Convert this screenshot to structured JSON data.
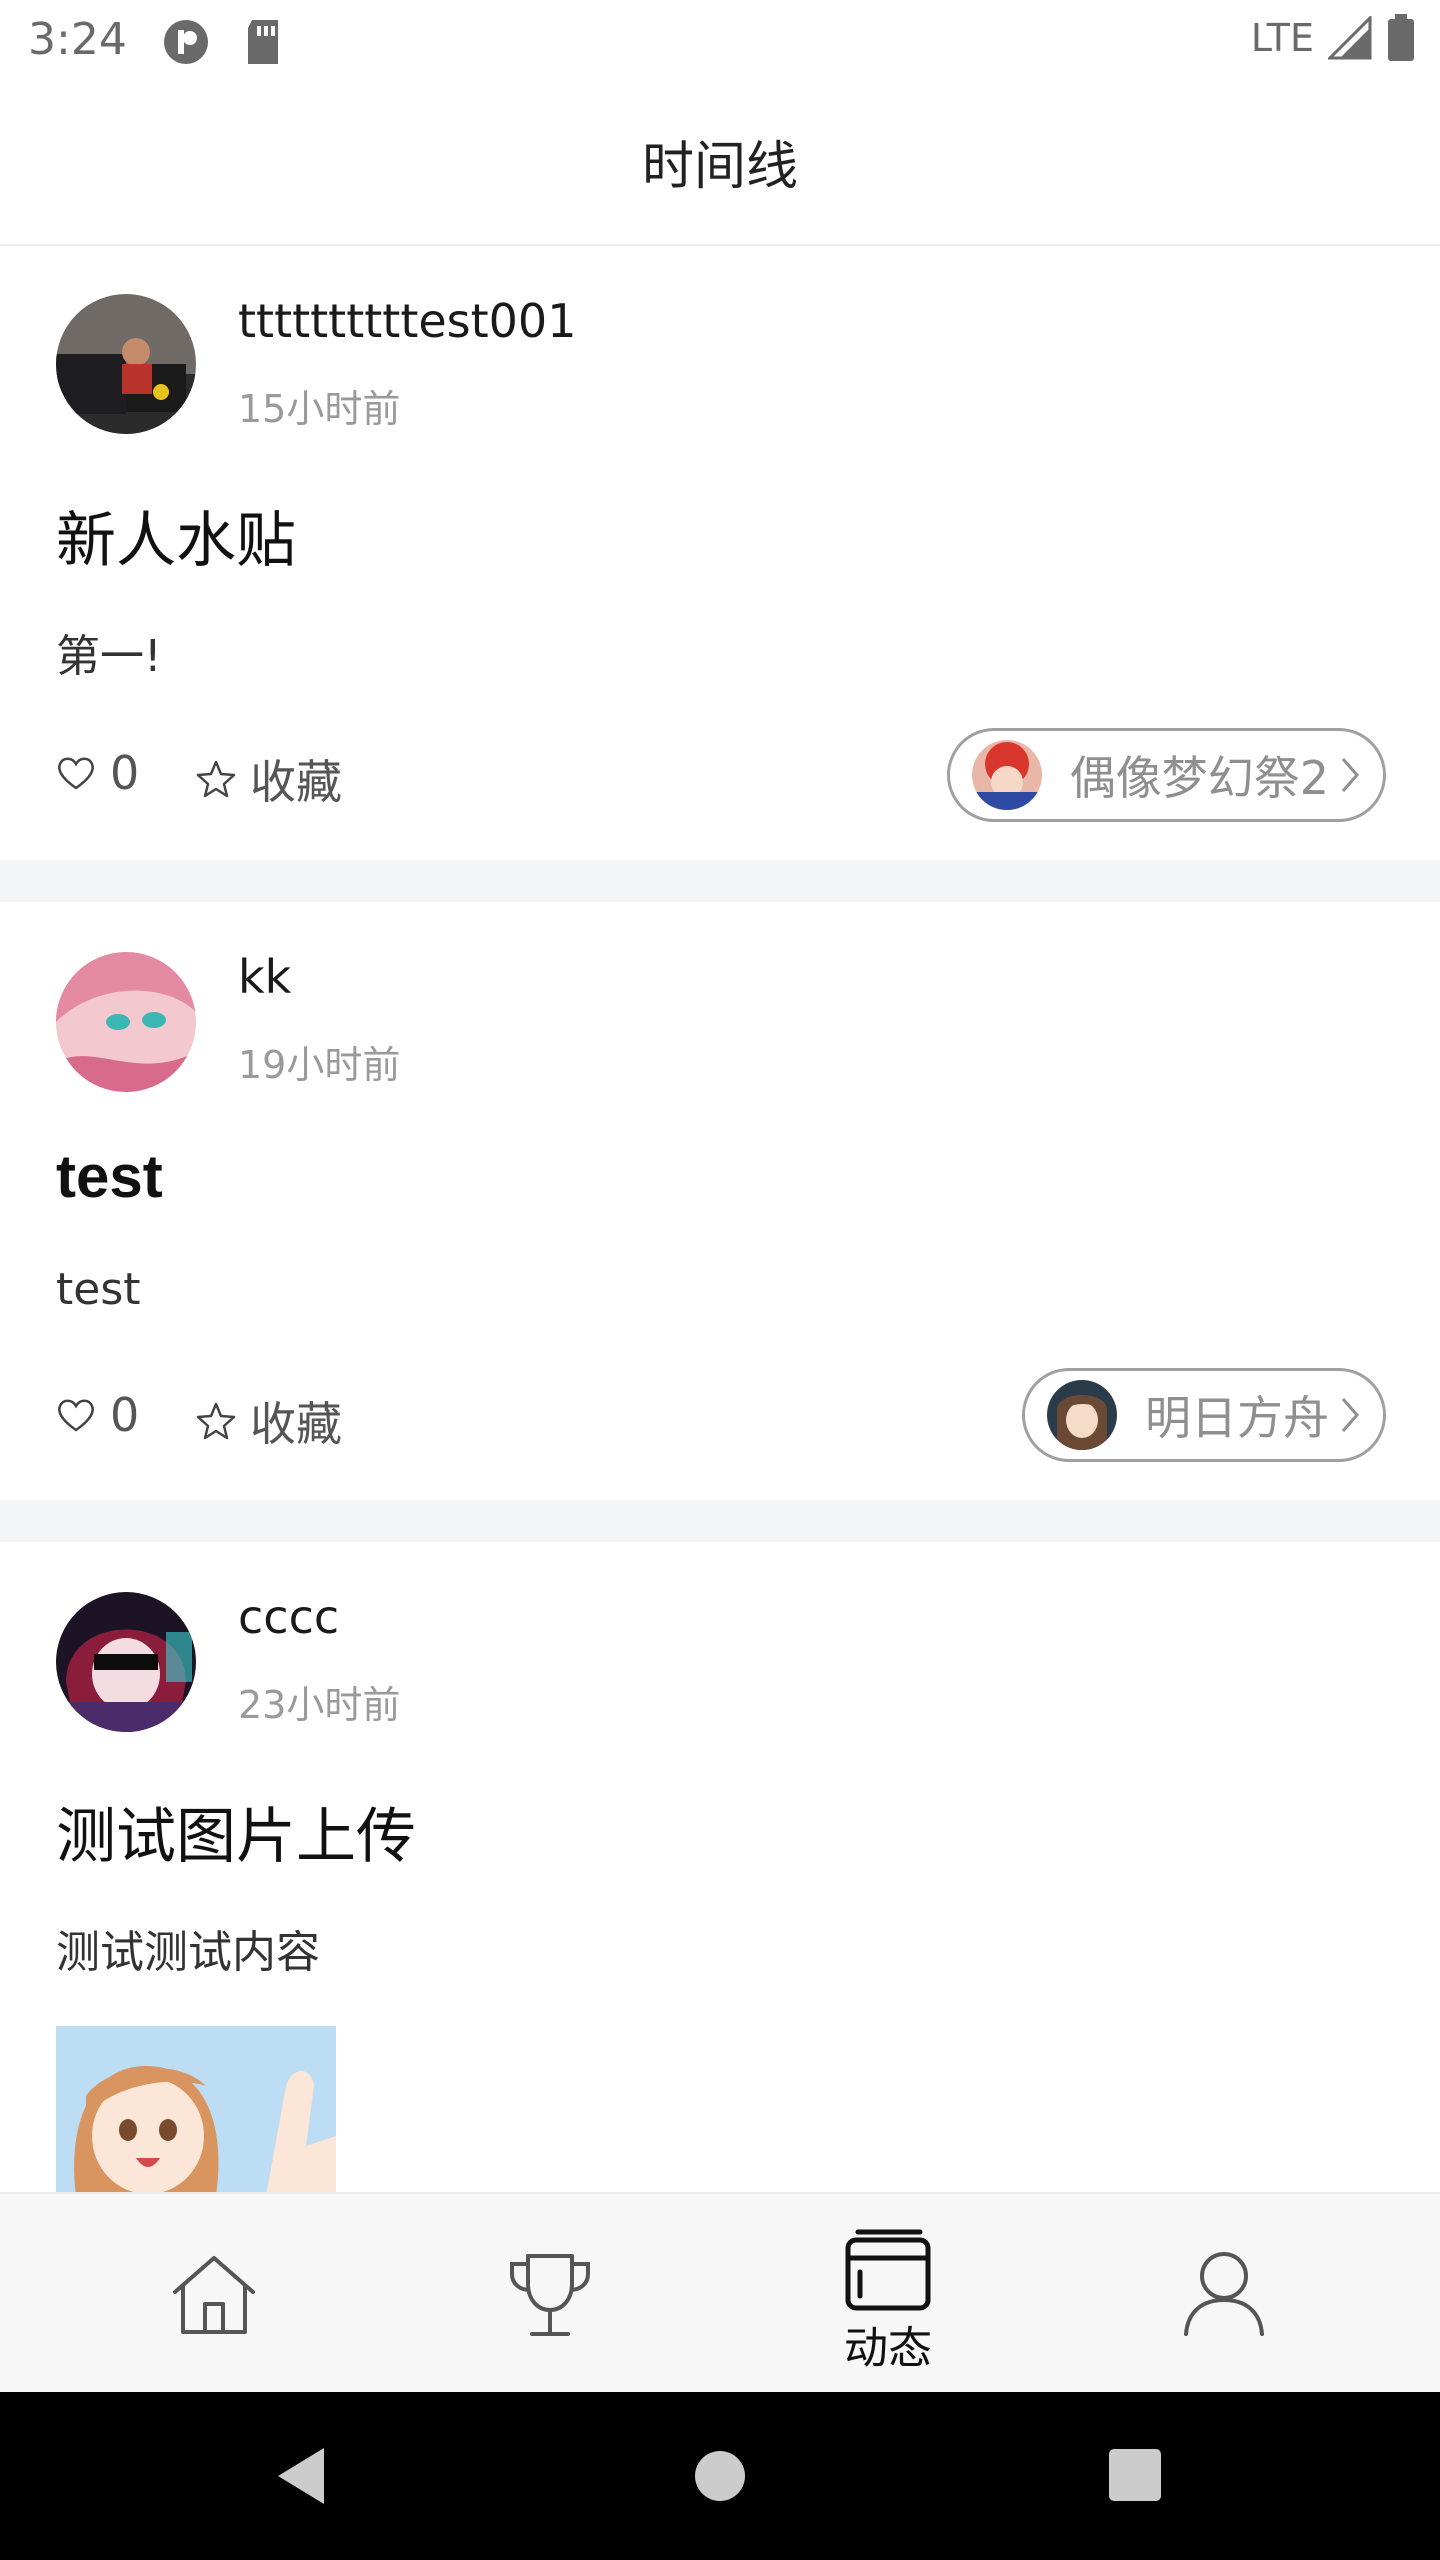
{
  "status_bar": {
    "time": "3:24",
    "network": "LTE"
  },
  "header": {
    "title": "时间线"
  },
  "posts": [
    {
      "author": "ttttttttttest001",
      "time": "15小时前",
      "title": "新人水贴",
      "content": "第一!",
      "likes": "0",
      "favorite_label": "收藏",
      "tag": "偶像梦幻祭2"
    },
    {
      "author": "kk",
      "time": "19小时前",
      "title": "test",
      "content": "test",
      "likes": "0",
      "favorite_label": "收藏",
      "tag": "明日方舟"
    },
    {
      "author": "cccc",
      "time": "23小时前",
      "title": "测试图片上传",
      "content": "测试测试内容"
    }
  ],
  "bottom_nav": [
    {
      "icon": "home-icon",
      "label": ""
    },
    {
      "icon": "trophy-icon",
      "label": ""
    },
    {
      "icon": "feed-icon",
      "label": "动态",
      "active": true
    },
    {
      "icon": "profile-icon",
      "label": ""
    }
  ],
  "colors": {
    "separator": "#f4f5f7",
    "muted_text": "#9a9a9a",
    "pill_border": "#a0a0a0"
  }
}
